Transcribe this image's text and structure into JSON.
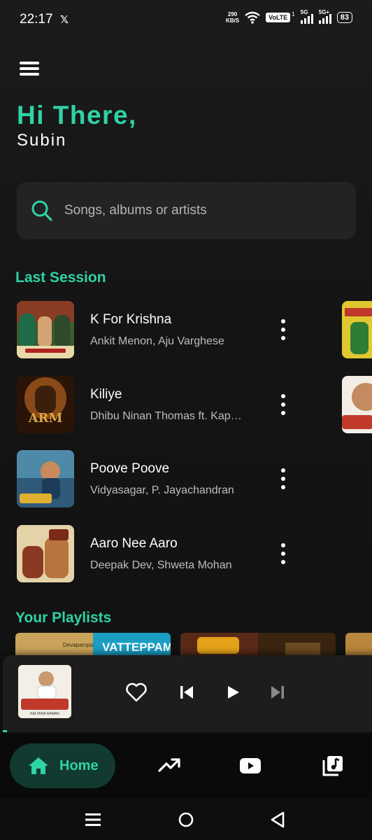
{
  "status_bar": {
    "time": "22:17",
    "notification_icon": "x-logo-icon",
    "net_speed_value": "290",
    "net_speed_unit": "KB/S",
    "volte": "VoLTE",
    "volte_sim": "1",
    "signal1_label": "5G",
    "signal2_label": "5G+",
    "battery": "83"
  },
  "greeting": {
    "title": "Hi There,",
    "name": "Subin"
  },
  "search": {
    "placeholder": "Songs, albums or artists"
  },
  "last_session": {
    "heading": "Last Session",
    "songs": [
      {
        "title": "K For Krishna",
        "artist": "Ankit Menon, Aju Varghese"
      },
      {
        "title": "Kiliye",
        "artist": "Dhibu Ninan Thomas ft. Kapil Kapilan"
      },
      {
        "title": "Poove Poove",
        "artist": "Vidyasagar, P. Jayachandran"
      },
      {
        "title": "Aaro Nee Aaro",
        "artist": "Deepak Dev, Shweta Mohan"
      }
    ]
  },
  "playlists": {
    "heading": "Your Playlists",
    "visible_labels": [
      "VATTEPPAM",
      "Devapampa"
    ]
  },
  "mini_player": {
    "art_label": "KALYANA RAMAN"
  },
  "bottom_nav": {
    "home_label": "Home",
    "items": [
      "home-icon",
      "trending-icon",
      "youtube-icon",
      "library-icon"
    ]
  },
  "colors": {
    "accent": "#2ed3a6",
    "background": "#111111",
    "card": "#232323",
    "home_pill": "#123a30"
  }
}
